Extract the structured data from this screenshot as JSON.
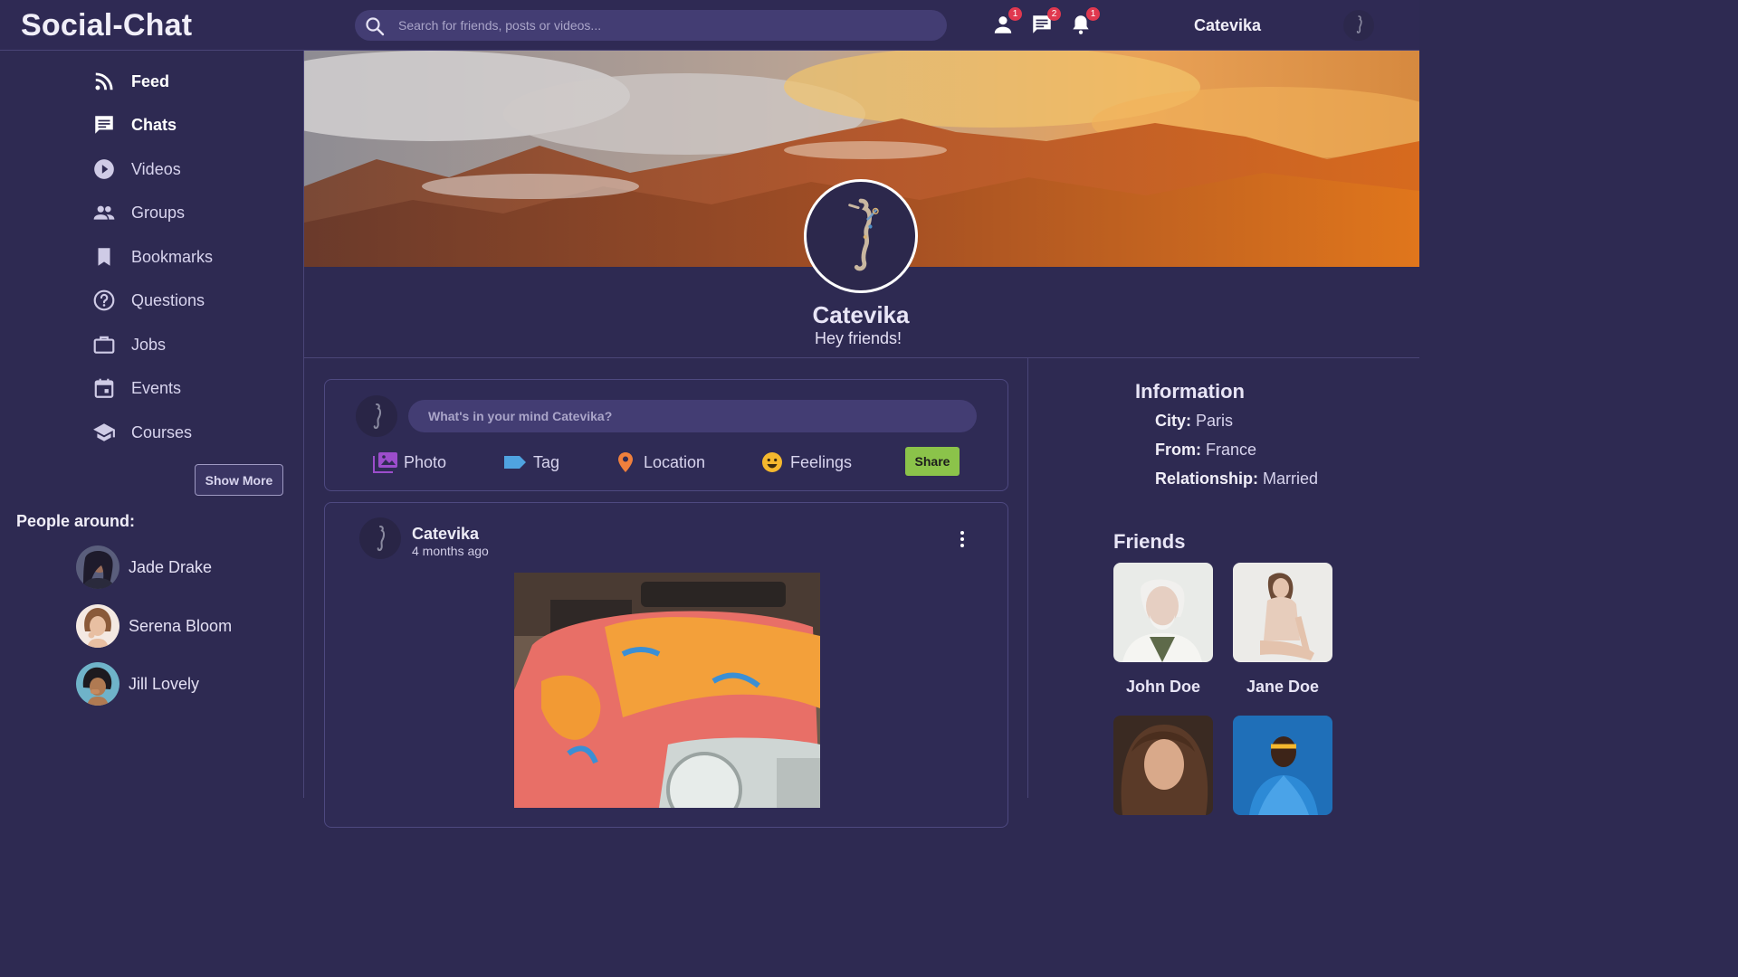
{
  "app": {
    "title": "Social-Chat"
  },
  "search": {
    "placeholder": "Search for friends, posts or videos..."
  },
  "topbar": {
    "friend_requests_count": "1",
    "messages_count": "2",
    "notifications_count": "1",
    "username": "Catevika"
  },
  "sidebar": {
    "items": [
      {
        "label": "Feed",
        "icon": "rss-feed-icon"
      },
      {
        "label": "Chats",
        "icon": "chat-icon"
      },
      {
        "label": "Videos",
        "icon": "play-circle-icon"
      },
      {
        "label": "Groups",
        "icon": "group-icon"
      },
      {
        "label": "Bookmarks",
        "icon": "bookmark-icon"
      },
      {
        "label": "Questions",
        "icon": "help-circle-icon"
      },
      {
        "label": "Jobs",
        "icon": "briefcase-icon"
      },
      {
        "label": "Events",
        "icon": "calendar-icon"
      },
      {
        "label": "Courses",
        "icon": "school-icon"
      }
    ],
    "show_more_label": "Show More",
    "people_title": "People around:",
    "people": [
      {
        "name": "Jade Drake"
      },
      {
        "name": "Serena Bloom"
      },
      {
        "name": "Jill Lovely"
      }
    ]
  },
  "profile": {
    "name": "Catevika",
    "status": "Hey friends!"
  },
  "composer": {
    "placeholder": "What's in your mind Catevika?",
    "options": [
      {
        "label": "Photo",
        "icon": "photo-library-icon",
        "color": "#9c4dcc"
      },
      {
        "label": "Tag",
        "icon": "label-icon",
        "color": "#4fa3e0"
      },
      {
        "label": "Location",
        "icon": "location-pin-icon",
        "color": "#f0803c"
      },
      {
        "label": "Feelings",
        "icon": "smiley-icon",
        "color": "#f5b82e"
      }
    ],
    "share_label": "Share"
  },
  "post": {
    "author": "Catevika",
    "time": "4 months ago"
  },
  "info": {
    "title": "Information",
    "rows": [
      {
        "key": "City:",
        "value": "Paris"
      },
      {
        "key": "From:",
        "value": "France"
      },
      {
        "key": "Relationship:",
        "value": "Married"
      }
    ]
  },
  "friends": {
    "title": "Friends",
    "list": [
      {
        "name": "John Doe"
      },
      {
        "name": "Jane Doe"
      },
      {
        "name": ""
      },
      {
        "name": ""
      }
    ]
  },
  "colors": {
    "background": "#2e2a52",
    "input": "#433d73",
    "badge": "#e0384f",
    "share": "#8bc34a",
    "border": "#4a4577"
  }
}
